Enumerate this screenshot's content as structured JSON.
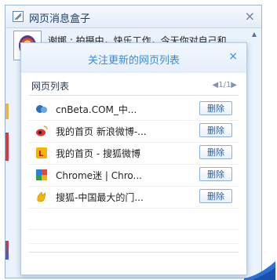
{
  "outer": {
    "title": "网页消息盒子",
    "close": "×",
    "message": "谢娜 : 拍摄中，快乐工作，今天你对自己和"
  },
  "dialog": {
    "title": "关注更新的网页列表",
    "close": "×",
    "list_label": "网页列表",
    "pager": "◀1/1▶",
    "delete_label": "删除",
    "items": [
      {
        "name": "cnBeta.COM_中...",
        "icon": "cnbeta-icon"
      },
      {
        "name": "我的首页 新浪微博-...",
        "icon": "weibo-icon"
      },
      {
        "name": "我的首页 - 搜狐微博",
        "icon": "sohu-weibo-icon"
      },
      {
        "name": "Chrome迷 | Chro...",
        "icon": "chrome-icon"
      },
      {
        "name": "搜狐-中国最大的门...",
        "icon": "sohu-icon"
      }
    ]
  },
  "colors": {
    "accent": "#3e8ad6",
    "border": "#b6c9df"
  }
}
